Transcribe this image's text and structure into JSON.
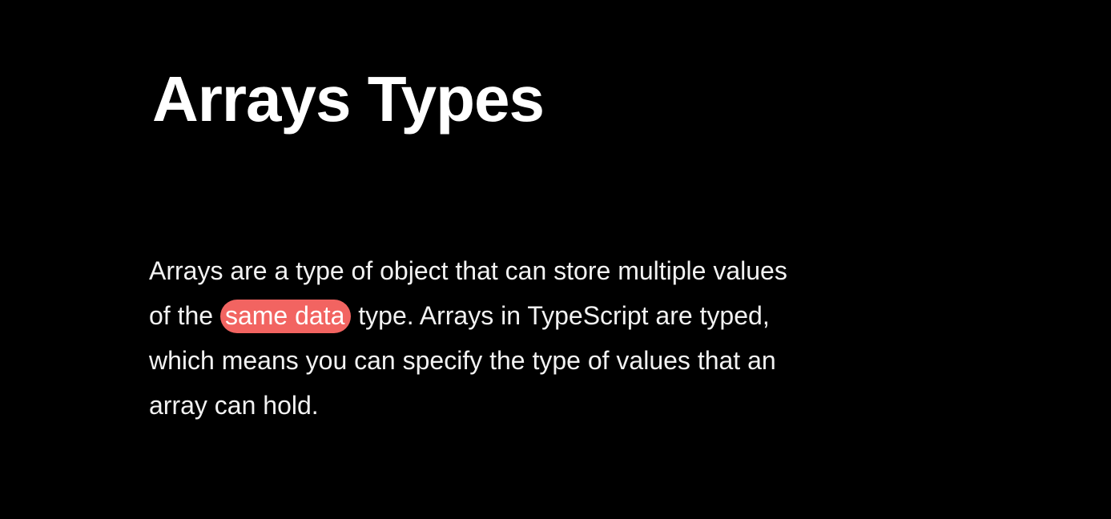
{
  "slide": {
    "title": "Arrays Types",
    "paragraph": {
      "line1": "Arrays are a type of object that can store multiple values",
      "line2_before": "of the ",
      "line2_highlight": "same data",
      "line2_after": " type. Arrays in TypeScript are typed,",
      "line3": "which means you can specify the type of values that an",
      "line4": "array can hold."
    },
    "colors": {
      "background": "#000000",
      "text": "#ffffff",
      "highlight": "#f26461"
    }
  }
}
